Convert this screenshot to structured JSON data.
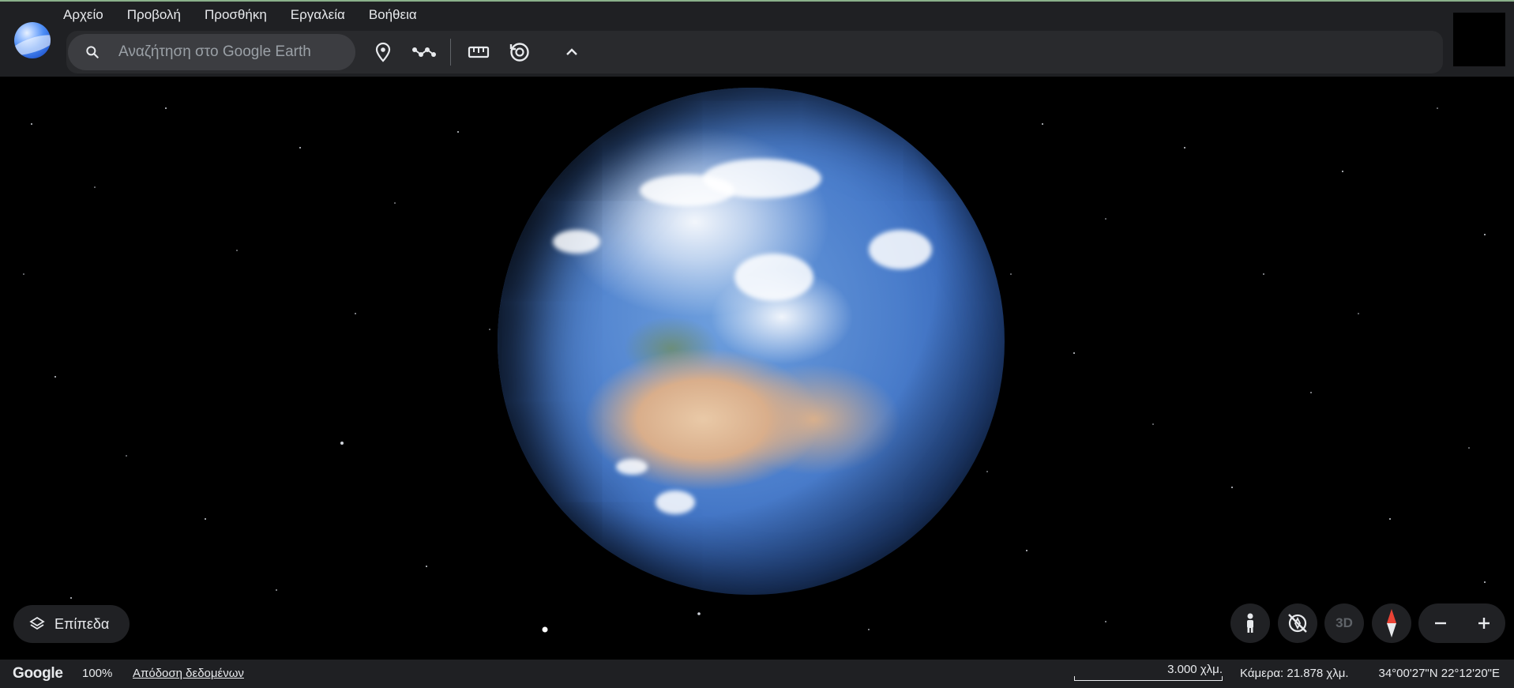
{
  "menu": {
    "items": [
      "Αρχείο",
      "Προβολή",
      "Προσθήκη",
      "Εργαλεία",
      "Βοήθεια"
    ]
  },
  "search": {
    "placeholder": "Αναζήτηση στο Google Earth",
    "icon": "search-icon"
  },
  "toolbar": {
    "icons": [
      "placemark-icon",
      "path-icon",
      "ruler-icon",
      "history-icon",
      "chevron-up-icon"
    ]
  },
  "map": {
    "layers_label": "Επίπεδα",
    "view_3d_label": "3D",
    "zoom_out_label": "−",
    "zoom_in_label": "+"
  },
  "status": {
    "brand": "Google",
    "zoom_percent": "100%",
    "attribution": "Απόδοση δεδομένων",
    "scale": "3.000 χλμ.",
    "camera": "Κάμερα: 21.878 χλμ.",
    "coordinates": "34°00'27\"N 22°12'20\"E"
  },
  "colors": {
    "topbar": "#1f2023",
    "toolbar": "#292a2d",
    "search_bg": "#3c3d41",
    "compass_red": "#ea4335"
  }
}
